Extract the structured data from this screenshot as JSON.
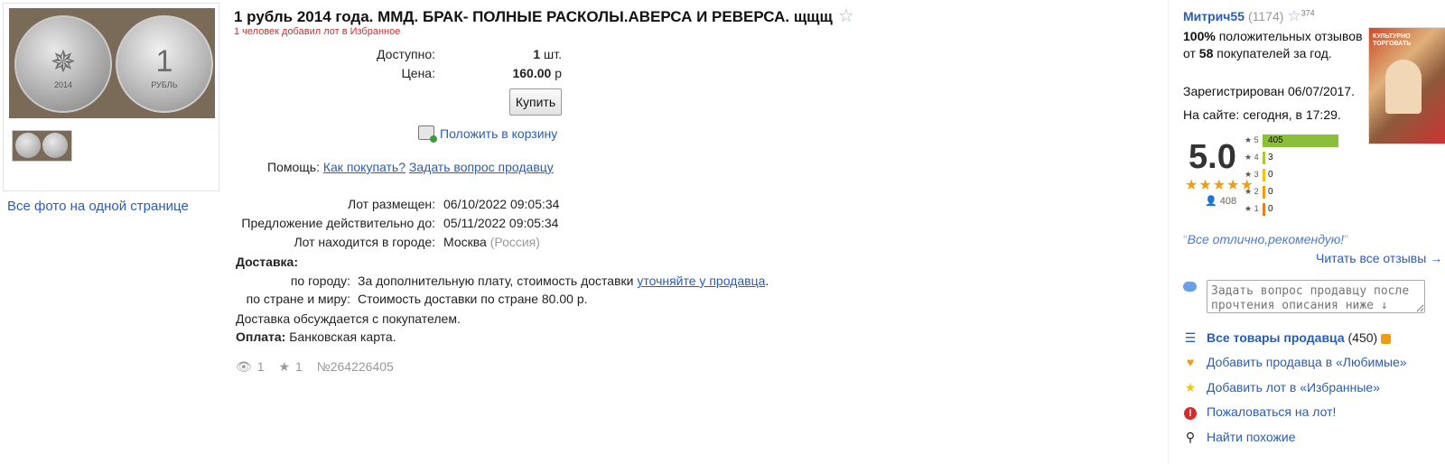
{
  "lot": {
    "title": "1 рубль 2014 года. ММД. БРАК- ПОЛНЫЕ РАСКОЛЫ.АВЕРСА И РЕВЕРСА. щщщ",
    "fav_note": "1 человек добавил лот в Избранное",
    "all_photos": "Все фото на одной странице",
    "coin_reverse_glyph": "1",
    "coin_reverse_caption": "РУБЛЬ",
    "coin_obverse_caption": "2014"
  },
  "purchase": {
    "available_label": "Доступно:",
    "available_value": "1",
    "available_unit": "шт.",
    "price_label": "Цена:",
    "price_value": "160.00",
    "price_unit": "р",
    "buy_label": "Купить",
    "cart_label": "Положить в корзину"
  },
  "help": {
    "label": "Помощь:",
    "how_to_buy": "Как покупать?",
    "ask_seller": "Задать вопрос продавцу"
  },
  "details": {
    "posted_label": "Лот размещен:",
    "posted_value": "06/10/2022 09:05:34",
    "valid_label": "Предложение действительно до:",
    "valid_value": "05/11/2022 09:05:34",
    "city_label": "Лот находится в городе:",
    "city_value": "Москва",
    "country_value": "(Россия)"
  },
  "delivery": {
    "title": "Доставка:",
    "city_label": "по городу:",
    "city_text": "За дополнительную плату, стоимость доставки",
    "city_link": "уточняйте у продавца",
    "city_end": ".",
    "country_label": "по стране и миру:",
    "country_text": "Стоимость доставки по стране 80.00 р.",
    "note": "Доставка обсуждается с покупателем.",
    "payment_label": "Оплата:",
    "payment_value": "Банковская карта."
  },
  "stats": {
    "views": "1",
    "favorites": "1",
    "lot_number": "№264226405"
  },
  "seller": {
    "name": "Митрич55",
    "rating_count": "(1174)",
    "stars_count": "374",
    "positive_pct": "100%",
    "positive_text": " положительных отзывов от ",
    "buyers": "58",
    "buyers_text": " покупателей за год.",
    "registered": "Зарегистрирован 06/07/2017.",
    "online": "На сайте: сегодня, в 17:29.",
    "poster_text": "КУЛЬТУРНО ТОРГОВАТЬ"
  },
  "rating": {
    "score": "5.0",
    "stars": "★★★★★",
    "voters": "408",
    "breakdown": [
      {
        "label": "★ 5",
        "count": 405,
        "color": "#8bbf3a"
      },
      {
        "label": "★ 4",
        "count": 3,
        "color": "#a8c83a"
      },
      {
        "label": "★ 3",
        "count": 0,
        "color": "#f1c40f"
      },
      {
        "label": "★ 2",
        "count": 0,
        "color": "#f39c12"
      },
      {
        "label": "★ 1",
        "count": 0,
        "color": "#e67e22"
      }
    ]
  },
  "review": {
    "quote": "Все отлично,рекомендую!",
    "read_all": "Читать все отзывы →"
  },
  "actions": {
    "ask_placeholder": "Задать вопрос продавцу после прочтения описания ниже ↓",
    "all_items": "Все товары продавца",
    "all_items_count": "(450)",
    "add_seller_fav": "Добавить продавца в «Любимые»",
    "add_lot_fav": "Добавить лот в «Избранные»",
    "report": "Пожаловаться на лот!",
    "find_similar": "Найти похожие"
  },
  "colors": {
    "link": "#2a5db0",
    "fav_note": "#d12d2d",
    "star_outline": "#9ab8e8",
    "rating_star": "#f39c12"
  }
}
